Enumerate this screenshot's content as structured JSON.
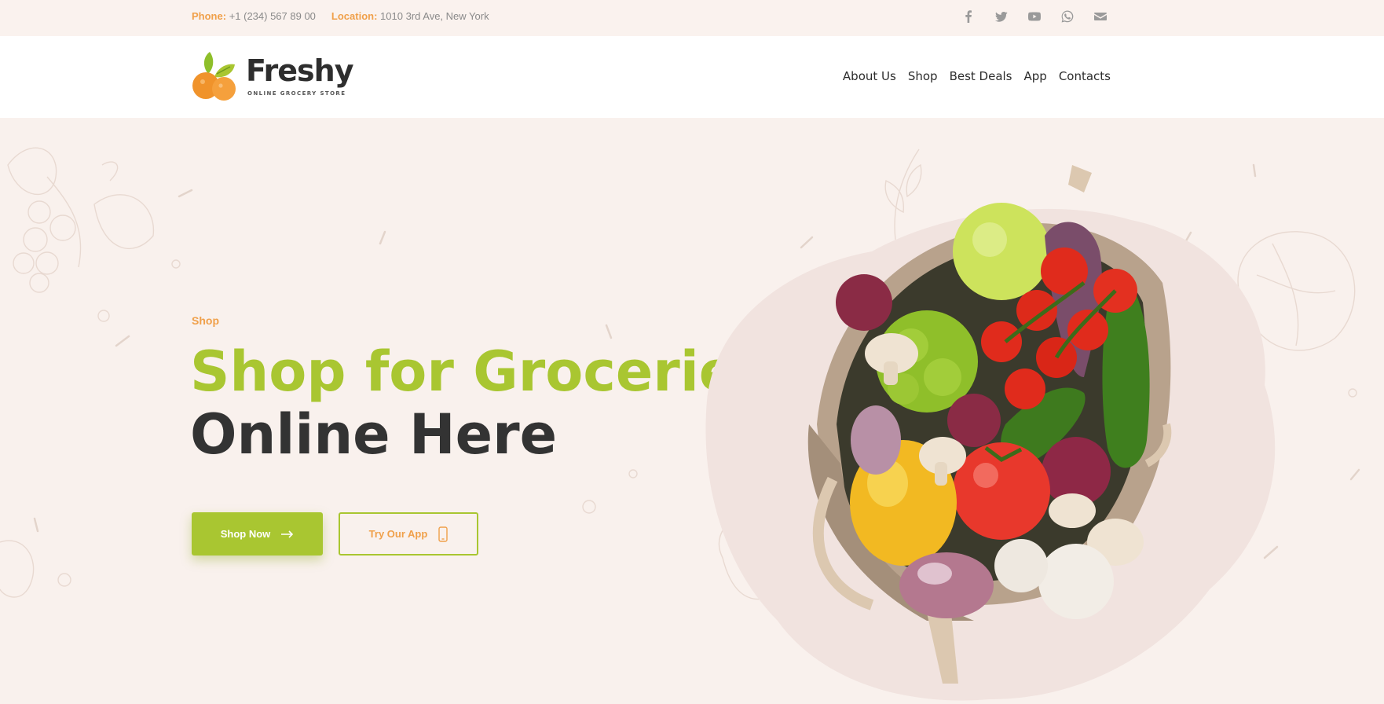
{
  "topbar": {
    "phone_label": "Phone:",
    "phone_value": "+1 (234) 567 89 00",
    "location_label": "Location:",
    "location_value": "1010 3rd Ave, New York",
    "social_icons": [
      "facebook-icon",
      "twitter-icon",
      "youtube-icon",
      "whatsapp-icon",
      "mail-icon"
    ]
  },
  "header": {
    "logo_name": "Freshy",
    "logo_tagline": "ONLINE GROCERY STORE",
    "nav": [
      {
        "label": "About Us"
      },
      {
        "label": "Shop"
      },
      {
        "label": "Best Deals"
      },
      {
        "label": "App"
      },
      {
        "label": "Contacts"
      }
    ]
  },
  "hero": {
    "eyebrow": "Shop",
    "title_line1": "Shop for Groceries",
    "title_line2": "Online Here",
    "primary_button": "Shop Now",
    "secondary_button": "Try Our App"
  },
  "colors": {
    "accent_green": "#a9c631",
    "accent_orange": "#f0a04a",
    "hero_bg": "#f9f1ed",
    "text_dark": "#333333"
  }
}
